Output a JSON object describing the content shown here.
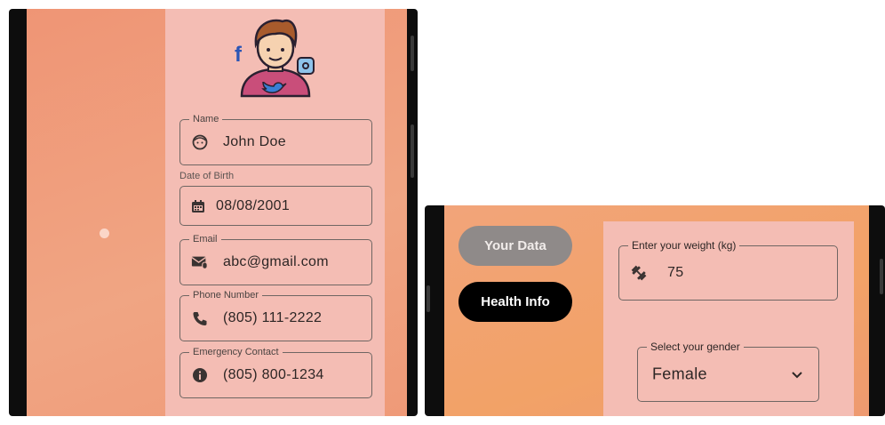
{
  "profile": {
    "avatar_icons": [
      "facebook-icon",
      "instagram-icon",
      "twitter-icon"
    ],
    "fields": [
      {
        "label": "Name",
        "value": "John Doe",
        "icon": "face-icon"
      },
      {
        "caption": "Date of Birth",
        "value": "08/08/2001",
        "icon": "calendar-icon"
      },
      {
        "label": "Email",
        "value": "abc@gmail.com",
        "icon": "mail-icon"
      },
      {
        "label": "Phone Number",
        "value": "(805) 111-2222",
        "icon": "phone-icon"
      },
      {
        "label": "Emergency Contact",
        "value": "(805) 800-1234",
        "icon": "info-icon"
      }
    ]
  },
  "health": {
    "tabs": {
      "your_data": "Your Data",
      "health_info": "Health Info"
    },
    "weight": {
      "label": "Enter your weight (kg)",
      "value": "75",
      "icon": "dumbbell-icon"
    },
    "gender": {
      "label": "Select your gender",
      "value": "Female",
      "icon": "chevron-down-icon"
    }
  },
  "colors": {
    "panel": "#f4bdb4",
    "background": "#ef9575",
    "active_tab": "#000000",
    "inactive_tab": "#8f8a89"
  }
}
